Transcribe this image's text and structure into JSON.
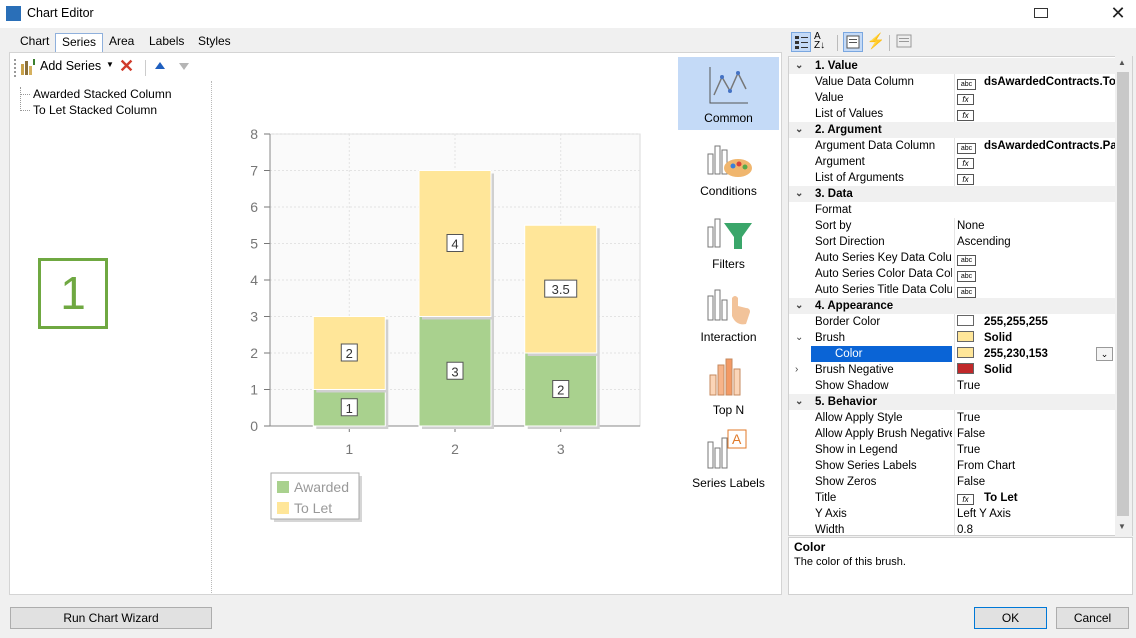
{
  "window": {
    "title": "Chart Editor"
  },
  "tabs": [
    "Chart",
    "Series",
    "Area",
    "Labels",
    "Styles"
  ],
  "toolbar": {
    "add_series": "Add Series"
  },
  "series_list": [
    "Awarded Stacked Column",
    "To Let Stacked Column"
  ],
  "overlay_number": "1",
  "chart_data": {
    "type": "bar",
    "stacked": true,
    "categories": [
      "1",
      "2",
      "3"
    ],
    "series": [
      {
        "name": "Awarded",
        "values": [
          1,
          3,
          2
        ],
        "color": "#a9d18e"
      },
      {
        "name": "To Let",
        "values": [
          2,
          4,
          3.5
        ],
        "color": "#ffe699"
      }
    ],
    "ylim": [
      0,
      8
    ],
    "yticks": [
      "0",
      "1",
      "2",
      "3",
      "4",
      "5",
      "6",
      "7",
      "8"
    ],
    "data_labels": [
      [
        "1",
        "3",
        "2"
      ],
      [
        "2",
        "4",
        "3.5"
      ]
    ],
    "legend_position": "bottom-left",
    "grid": true
  },
  "side_icons": [
    "Common",
    "Conditions",
    "Filters",
    "Interaction",
    "Top N",
    "Series Labels"
  ],
  "properties": [
    {
      "cat": "1. Value"
    },
    {
      "name": "Value Data Column",
      "icon": "abc",
      "value": "dsAwardedContracts.To",
      "bold": true
    },
    {
      "name": "Value",
      "icon": "fx",
      "value": ""
    },
    {
      "name": "List of Values",
      "icon": "fx",
      "value": ""
    },
    {
      "cat": "2. Argument"
    },
    {
      "name": "Argument Data Column",
      "icon": "abc",
      "value": "dsAwardedContracts.Pa",
      "bold": true
    },
    {
      "name": "Argument",
      "icon": "fx",
      "value": ""
    },
    {
      "name": "List of Arguments",
      "icon": "fx",
      "value": ""
    },
    {
      "cat": "3. Data"
    },
    {
      "name": "Format",
      "value": ""
    },
    {
      "name": "Sort by",
      "value": "None"
    },
    {
      "name": "Sort Direction",
      "value": "Ascending"
    },
    {
      "name": "Auto Series Key Data Column",
      "icon": "abc",
      "value": ""
    },
    {
      "name": "Auto Series Color Data Column",
      "icon": "abc",
      "value": ""
    },
    {
      "name": "Auto Series Title Data Column",
      "icon": "abc",
      "value": ""
    },
    {
      "cat": "4. Appearance"
    },
    {
      "name": "Border Color",
      "swatch": "#ffffff",
      "value": "255,255,255",
      "bold": true
    },
    {
      "name": "Brush",
      "swatch": "#ffe699",
      "value": "Solid",
      "bold": true,
      "expand": "v"
    },
    {
      "name": "Color",
      "swatch": "#ffe699",
      "value": "255,230,153",
      "bold": true,
      "selected": true
    },
    {
      "name": "Brush Negative",
      "swatch": "#c0282a",
      "value": "Solid",
      "bold": true,
      "expand": ">"
    },
    {
      "name": "Show Shadow",
      "value": "True"
    },
    {
      "cat": "5. Behavior"
    },
    {
      "name": "Allow Apply Style",
      "value": "True"
    },
    {
      "name": "Allow Apply Brush Negative",
      "value": "False"
    },
    {
      "name": "Show in Legend",
      "value": "True"
    },
    {
      "name": "Show Series Labels",
      "value": "From Chart"
    },
    {
      "name": "Show Zeros",
      "value": "False"
    },
    {
      "name": "Title",
      "icon": "fx",
      "value": "To Let",
      "bold": true
    },
    {
      "name": "Y Axis",
      "value": "Left Y Axis"
    },
    {
      "name": "Width",
      "value": "0.8"
    }
  ],
  "description": {
    "title": "Color",
    "text": "The color of this brush."
  },
  "buttons": {
    "wizard": "Run Chart Wizard",
    "ok": "OK",
    "cancel": "Cancel"
  }
}
